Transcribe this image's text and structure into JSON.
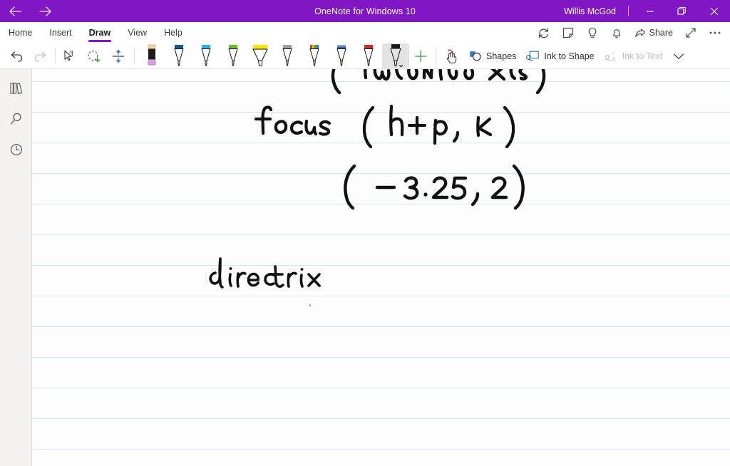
{
  "titlebar": {
    "app_title": "OneNote for Windows 10",
    "account_name": "Willis McGod",
    "back_icon": "back-arrow-icon",
    "forward_icon": "forward-arrow-icon",
    "minimize_label": "–",
    "restore_icon": "restore-window-icon",
    "close_label": "✕",
    "background_color": "#8117c4"
  },
  "ribbon": {
    "tabs": [
      {
        "label": "Home",
        "active": false
      },
      {
        "label": "Insert",
        "active": false
      },
      {
        "label": "Draw",
        "active": true
      },
      {
        "label": "View",
        "active": false
      },
      {
        "label": "Help",
        "active": false
      }
    ],
    "active_tab": "Draw",
    "accent_color": "#8117c4",
    "right_items": [
      {
        "name": "sync-icon",
        "label": ""
      },
      {
        "name": "sticky-note-icon",
        "label": ""
      },
      {
        "name": "lightbulb-icon",
        "label": ""
      },
      {
        "name": "notifications-bell-icon",
        "label": ""
      },
      {
        "name": "share-button",
        "label": "Share"
      },
      {
        "name": "expand-icon",
        "label": ""
      },
      {
        "name": "more-options-icon",
        "label": ""
      }
    ],
    "share_label": "Share"
  },
  "drawbar": {
    "undo_label": "Undo",
    "redo_label": "Redo",
    "tools": [
      {
        "name": "lasso-text-select-tool",
        "label": "Select"
      },
      {
        "name": "lasso-select-tool",
        "label": "Lasso Select"
      },
      {
        "name": "insert-space-tool",
        "label": "Insert Space"
      }
    ],
    "pens": [
      {
        "name": "eraser-tool",
        "label": "Eraser",
        "color": "#c98ad6",
        "selected": false
      },
      {
        "name": "pen-blue",
        "label": "Pen",
        "color": "#15558f",
        "selected": false
      },
      {
        "name": "pen-cyan",
        "label": "Pen",
        "color": "#27b4e8",
        "selected": false
      },
      {
        "name": "pen-green",
        "label": "Pen",
        "color": "#6cc020",
        "selected": false
      },
      {
        "name": "highlighter-yellow",
        "label": "Highlighter",
        "color": "#ffe600",
        "selected": false
      },
      {
        "name": "pen-silver",
        "label": "Pen",
        "color": "#9aa0a6",
        "selected": false
      },
      {
        "name": "pen-rainbow",
        "label": "Pen",
        "color": "#d9822b",
        "selected": false
      },
      {
        "name": "pen-galaxy",
        "label": "Pen",
        "color": "#3f5fa8",
        "selected": false
      },
      {
        "name": "pen-red",
        "label": "Pen",
        "color": "#d12a2a",
        "selected": false
      },
      {
        "name": "pen-black",
        "label": "Pen",
        "color": "#111111",
        "selected": true
      }
    ],
    "add_pen_label": "+",
    "touch_draw_label": "Draw with Touch",
    "shapes_label": "Shapes",
    "ink_to_shape_label": "Ink to Shape",
    "ink_to_text_label": "Ink to Text",
    "ink_to_text_disabled": true,
    "more_chevron": "chevron-down-icon"
  },
  "rail": {
    "items": [
      {
        "name": "notebooks-icon",
        "label": "Notebooks"
      },
      {
        "name": "search-icon",
        "label": "Search"
      },
      {
        "name": "recent-notes-icon",
        "label": "Recent Notes"
      }
    ]
  },
  "page": {
    "background_color": "#fdfdfd",
    "rule_color": "#d6e9f5",
    "rule_spacing_px": 43,
    "ink_notes": [
      {
        "name": "ink-line-horizontal-axis",
        "text": "( horizontal axis )"
      },
      {
        "name": "ink-line-focus",
        "text": "focus  ( h+p, k )"
      },
      {
        "name": "ink-line-coordinates",
        "text": "( - 3.25, 2 )"
      },
      {
        "name": "ink-line-directrix",
        "text": "directrix"
      }
    ]
  }
}
